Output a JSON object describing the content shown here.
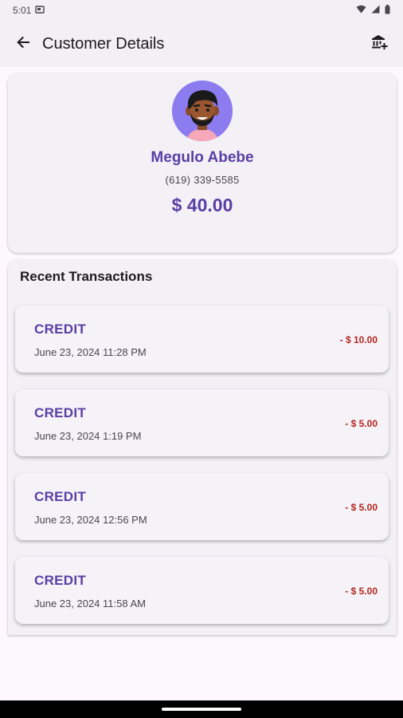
{
  "status_bar": {
    "time": "5:01",
    "icons": [
      "screenshot-icon",
      "wifi-icon",
      "signal-icon",
      "battery-icon"
    ]
  },
  "app_bar": {
    "title": "Customer Details",
    "back_icon": "arrow-back-icon",
    "action_icon": "bank-icon"
  },
  "customer": {
    "name": "Megulo Abebe",
    "phone": "(619) 339-5585",
    "balance": "$ 40.00"
  },
  "transactions": {
    "heading": "Recent Transactions",
    "items": [
      {
        "type": "CREDIT",
        "date": "June 23, 2024 11:28 PM",
        "amount": "- $ 10.00"
      },
      {
        "type": "CREDIT",
        "date": "June 23, 2024 1:19 PM",
        "amount": "- $ 5.00"
      },
      {
        "type": "CREDIT",
        "date": "June 23, 2024 12:56 PM",
        "amount": "- $ 5.00"
      },
      {
        "type": "CREDIT",
        "date": "June 23, 2024 11:58 AM",
        "amount": "- $ 5.00"
      }
    ]
  },
  "colors": {
    "accent": "#5a3ea5",
    "amount": "#b3261e",
    "avatar_bg": "#8c7cf0"
  }
}
